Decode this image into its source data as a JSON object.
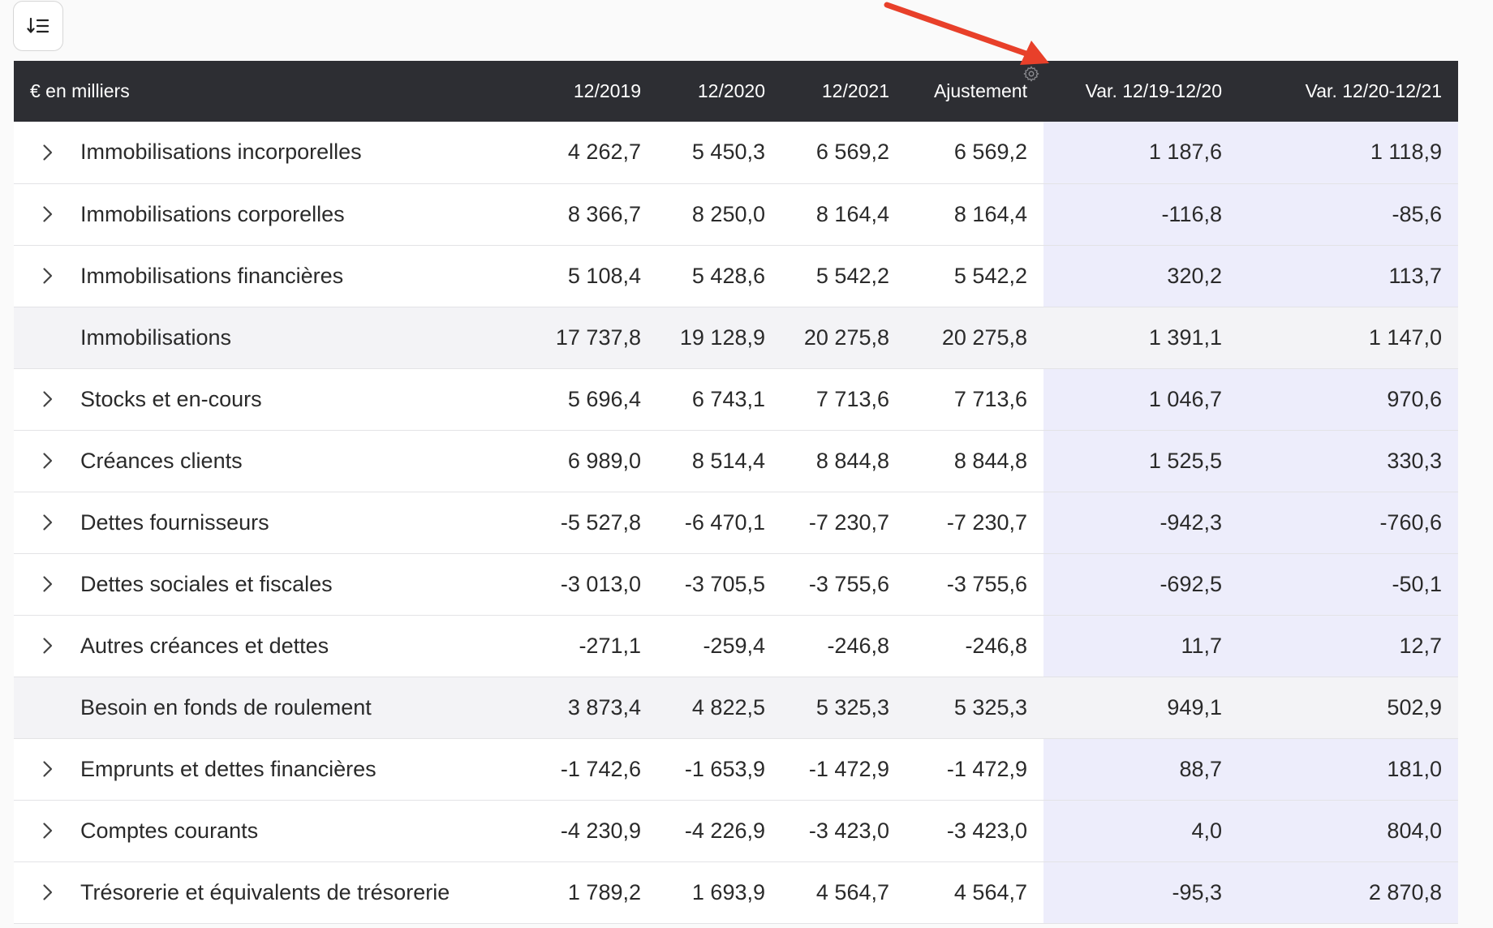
{
  "toolbar": {
    "sort_icon": "sort-descending-list-icon"
  },
  "table": {
    "columns": {
      "label": "€ en milliers",
      "y2019": "12/2019",
      "y2020": "12/2020",
      "y2021": "12/2021",
      "adjust": "Ajustement",
      "var1": "Var. 12/19-12/20",
      "var2": "Var. 12/20-12/21"
    },
    "rows": [
      {
        "label": "Immobilisations incorporelles",
        "expandable": true,
        "subtotal": false,
        "y2019": "4 262,7",
        "y2020": "5 450,3",
        "y2021": "6 569,2",
        "adjust": "6 569,2",
        "var1": "1 187,6",
        "var2": "1 118,9"
      },
      {
        "label": "Immobilisations corporelles",
        "expandable": true,
        "subtotal": false,
        "y2019": "8 366,7",
        "y2020": "8 250,0",
        "y2021": "8 164,4",
        "adjust": "8 164,4",
        "var1": "-116,8",
        "var2": "-85,6"
      },
      {
        "label": "Immobilisations financières",
        "expandable": true,
        "subtotal": false,
        "y2019": "5 108,4",
        "y2020": "5 428,6",
        "y2021": "5 542,2",
        "adjust": "5 542,2",
        "var1": "320,2",
        "var2": "113,7"
      },
      {
        "label": "Immobilisations",
        "expandable": false,
        "subtotal": true,
        "y2019": "17 737,8",
        "y2020": "19 128,9",
        "y2021": "20 275,8",
        "adjust": "20 275,8",
        "var1": "1 391,1",
        "var2": "1 147,0"
      },
      {
        "label": "Stocks et en-cours",
        "expandable": true,
        "subtotal": false,
        "y2019": "5 696,4",
        "y2020": "6 743,1",
        "y2021": "7 713,6",
        "adjust": "7 713,6",
        "var1": "1 046,7",
        "var2": "970,6"
      },
      {
        "label": "Créances clients",
        "expandable": true,
        "subtotal": false,
        "y2019": "6 989,0",
        "y2020": "8 514,4",
        "y2021": "8 844,8",
        "adjust": "8 844,8",
        "var1": "1 525,5",
        "var2": "330,3"
      },
      {
        "label": "Dettes fournisseurs",
        "expandable": true,
        "subtotal": false,
        "y2019": "-5 527,8",
        "y2020": "-6 470,1",
        "y2021": "-7 230,7",
        "adjust": "-7 230,7",
        "var1": "-942,3",
        "var2": "-760,6"
      },
      {
        "label": "Dettes sociales et fiscales",
        "expandable": true,
        "subtotal": false,
        "y2019": "-3 013,0",
        "y2020": "-3 705,5",
        "y2021": "-3 755,6",
        "adjust": "-3 755,6",
        "var1": "-692,5",
        "var2": "-50,1"
      },
      {
        "label": "Autres créances et dettes",
        "expandable": true,
        "subtotal": false,
        "y2019": "-271,1",
        "y2020": "-259,4",
        "y2021": "-246,8",
        "adjust": "-246,8",
        "var1": "11,7",
        "var2": "12,7"
      },
      {
        "label": "Besoin en fonds de roulement",
        "expandable": false,
        "subtotal": true,
        "y2019": "3 873,4",
        "y2020": "4 822,5",
        "y2021": "5 325,3",
        "adjust": "5 325,3",
        "var1": "949,1",
        "var2": "502,9"
      },
      {
        "label": "Emprunts et dettes financières",
        "expandable": true,
        "subtotal": false,
        "y2019": "-1 742,6",
        "y2020": "-1 653,9",
        "y2021": "-1 472,9",
        "adjust": "-1 472,9",
        "var1": "88,7",
        "var2": "181,0"
      },
      {
        "label": "Comptes courants",
        "expandable": true,
        "subtotal": false,
        "y2019": "-4 230,9",
        "y2020": "-4 226,9",
        "y2021": "-3 423,0",
        "adjust": "-3 423,0",
        "var1": "4,0",
        "var2": "804,0"
      },
      {
        "label": "Trésorerie et équivalents de trésorerie",
        "expandable": true,
        "subtotal": false,
        "y2019": "1 789,2",
        "y2020": "1 693,9",
        "y2021": "4 564,7",
        "adjust": "4 564,7",
        "var1": "-95,3",
        "var2": "2 870,8"
      }
    ]
  },
  "colors": {
    "header_bg": "#2d2e33",
    "variation_bg": "#ededfb",
    "subtotal_bg": "#f3f3f6",
    "annotation_arrow": "#e8402a"
  },
  "icons": {
    "expand": "chevron-right-icon",
    "column_settings": "gear-icon",
    "annotation": "red-arrow-annotation"
  }
}
